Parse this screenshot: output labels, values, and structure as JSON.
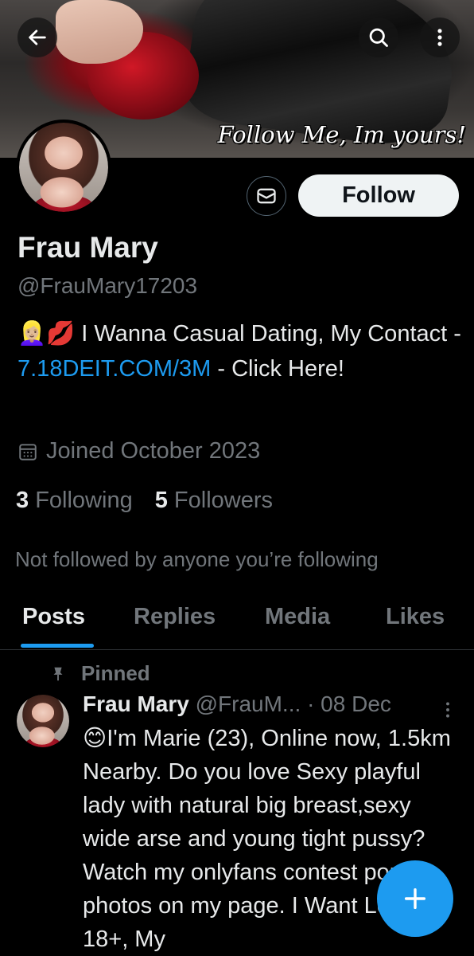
{
  "banner": {
    "caption": "Follow Me, Im yours!"
  },
  "header": {
    "back_icon": "arrow-left-icon",
    "search_icon": "search-icon",
    "more_icon": "more-vertical-icon"
  },
  "profile": {
    "name": "Frau Mary",
    "handle": "@FrauMary17203",
    "bio_emoji": "👱🏼‍♀️💋",
    "bio_text_1": " I Wanna Casual Dating, My Contact - ",
    "bio_link": "7.18DEIT.COM/3M",
    "bio_text_2": " - Click Here!",
    "joined": "Joined October 2023",
    "following_count": "3",
    "following_label": "Following",
    "followers_count": "5",
    "followers_label": "Followers",
    "not_followed": "Not followed by anyone you’re following"
  },
  "actions": {
    "follow_label": "Follow",
    "message_icon": "envelope-icon"
  },
  "tabs": [
    {
      "label": "Posts",
      "active": true
    },
    {
      "label": "Replies",
      "active": false
    },
    {
      "label": "Media",
      "active": false
    },
    {
      "label": "Likes",
      "active": false
    }
  ],
  "pinned_tweet": {
    "pinned_label": "Pinned",
    "author_name": "Frau Mary",
    "author_handle": "@FrauM...",
    "separator": "·",
    "date": "08 Dec",
    "text": "😊I'm Marie (23), Online now, 1.5km Nearby. Do you love Sexy playful lady with natural big breast,sexy wide arse and young tight pussy? Watch my onlyfans contest porn photos on my page.  I Want Love 18+, My"
  },
  "compose": {
    "icon": "plus-icon"
  },
  "colors": {
    "accent": "#1d9bf0",
    "background": "#000000",
    "muted_text": "#71767b",
    "primary_text": "#e7e9ea"
  }
}
